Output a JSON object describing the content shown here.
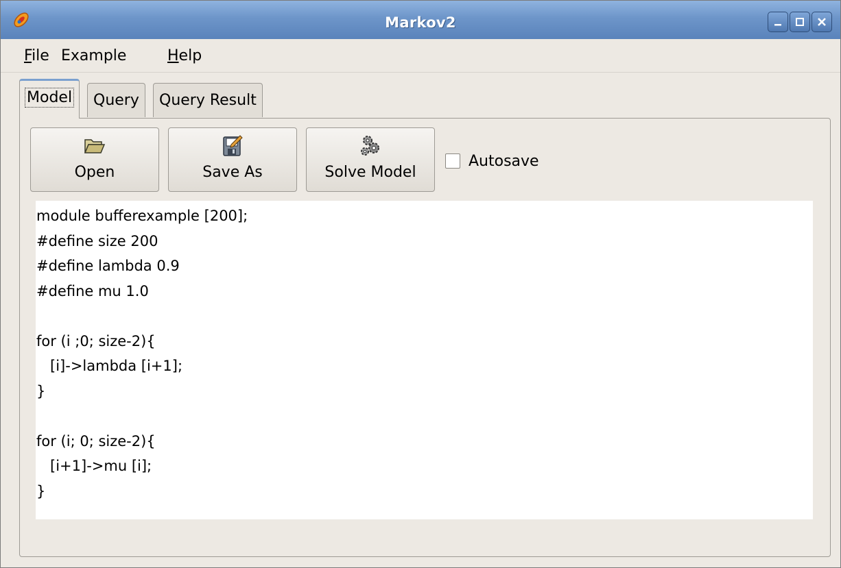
{
  "window": {
    "title": "Markov2",
    "buttons": {
      "minimize_icon": "minimize-icon",
      "maximize_icon": "maximize-icon",
      "close_icon": "close-icon"
    }
  },
  "menubar": {
    "items": [
      {
        "mnemonic": "F",
        "rest": "ile"
      },
      {
        "mnemonic": "",
        "rest": "Example"
      },
      {
        "mnemonic": "H",
        "rest": "elp"
      }
    ]
  },
  "tabs": [
    {
      "label": "Model",
      "active": true
    },
    {
      "label": "Query",
      "active": false
    },
    {
      "label": "Query Result",
      "active": false
    }
  ],
  "toolbar": {
    "open_label": "Open",
    "save_as_label": "Save As",
    "solve_label": "Solve Model",
    "autosave_label": "Autosave",
    "autosave_checked": false
  },
  "editor": {
    "lines": [
      "module bufferexample [200];",
      "#define size 200",
      "#define lambda 0.9",
      "#define mu 1.0",
      "",
      "for (i ;0; size-2){",
      "   [i]->lambda [i+1];",
      "}",
      "",
      "for (i; 0; size-2){",
      "   [i+1]->mu [i];",
      "}"
    ]
  },
  "colors": {
    "titlebar": "#6d95c9",
    "window_bg": "#ede9e3",
    "editor_bg": "#ffffff"
  }
}
